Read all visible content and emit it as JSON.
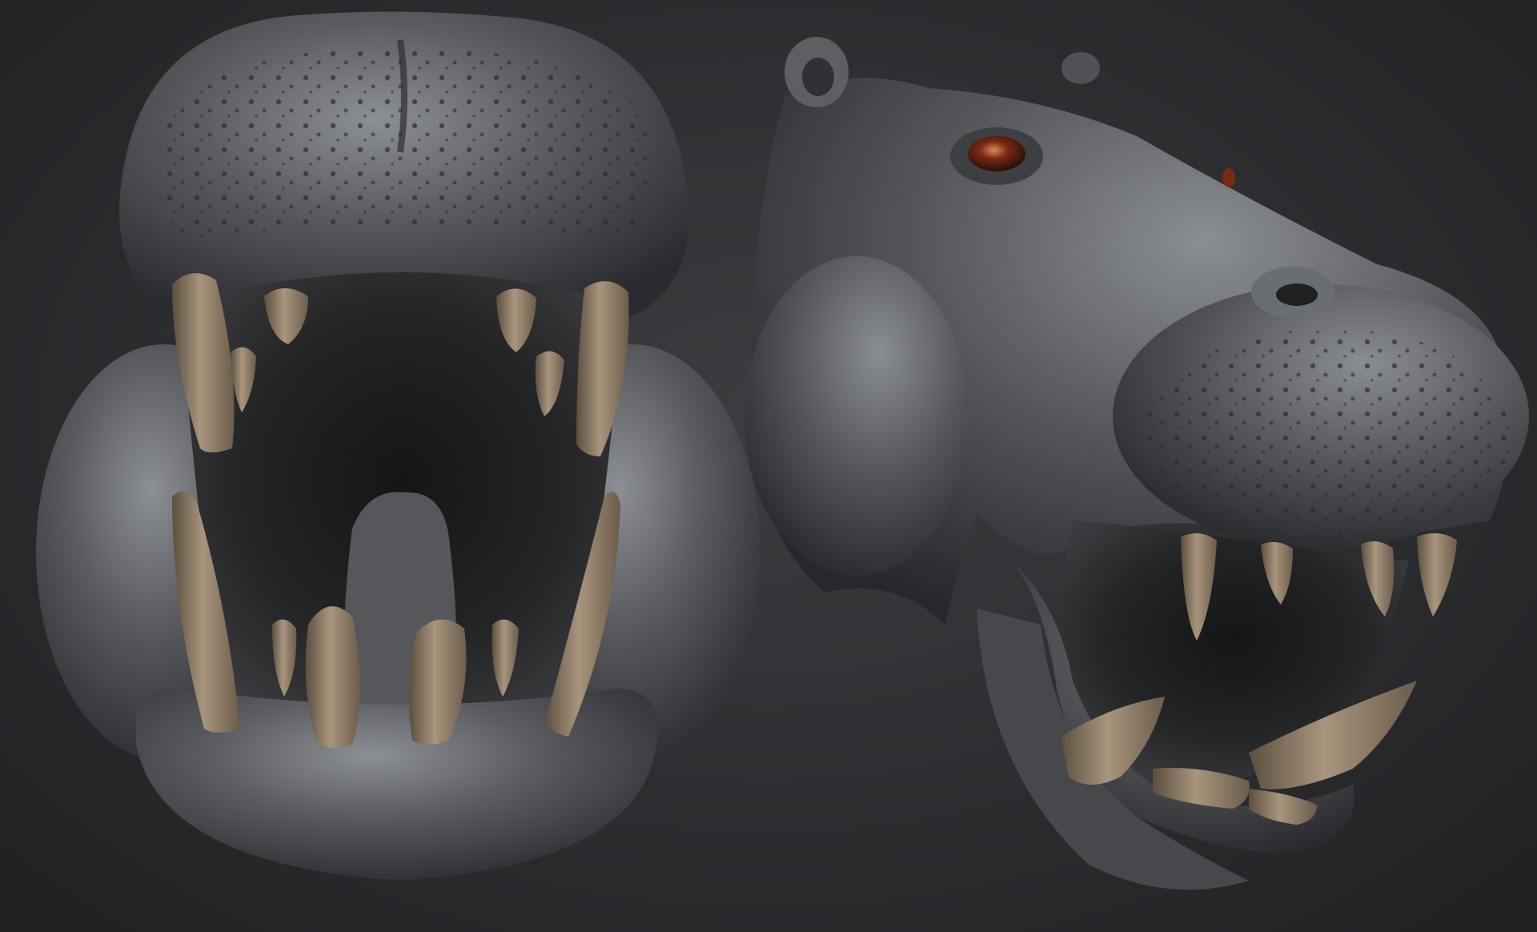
{
  "scene": {
    "subject": "",
    "views": [
      {
        "id": "front-view"
      },
      {
        "id": "side-view"
      }
    ]
  },
  "colors": {
    "background_center": "#3c3d40",
    "background_edge": "#1f2022",
    "skin": "#5a5c60",
    "skin_highlight": "#8c8f94",
    "skin_shadow": "#2a2b2e",
    "mouth_interior": "#232426",
    "tongue": "#55575b",
    "teeth": "#7d6c59",
    "teeth_highlight": "#a8957d",
    "eye": "#7a2a14",
    "eye_highlight": "#e08a5a"
  }
}
